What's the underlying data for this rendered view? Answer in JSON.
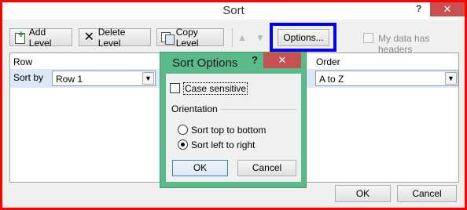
{
  "window": {
    "title": "Sort",
    "help": "?",
    "close": "✕"
  },
  "toolbar": {
    "add_level": "Add Level",
    "delete_level": "Delete Level",
    "copy_level": "Copy Level",
    "move_up": "▲",
    "move_down": "▼",
    "options": "Options...",
    "my_data_has_headers": "My data has headers",
    "headers_checked": false
  },
  "grid": {
    "col_row": "Row",
    "col_order": "Order",
    "sort_by_label": "Sort by",
    "row_value": "Row 1",
    "order_value": "A to Z"
  },
  "footer": {
    "ok": "OK",
    "cancel": "Cancel"
  },
  "sort_options": {
    "title": "Sort Options",
    "help": "?",
    "close": "✕",
    "case_sensitive": "Case sensitive",
    "case_sensitive_checked": false,
    "orientation_label": "Orientation",
    "top_to_bottom": "Sort top to bottom",
    "left_to_right": "Sort left to right",
    "selected_orientation": "left_to_right",
    "ok": "OK",
    "cancel": "Cancel"
  },
  "icons": {
    "add": "add-level-icon",
    "delete": "delete-x-icon",
    "copy": "copy-icon",
    "dropdown": "chevron-down-icon"
  },
  "colors": {
    "highlight_red": "#ff0000",
    "highlight_blue": "#0000ee",
    "options_dialog_border": "#5cb98a",
    "close_button": "#c75050",
    "selected_row": "#dbe9f9"
  }
}
